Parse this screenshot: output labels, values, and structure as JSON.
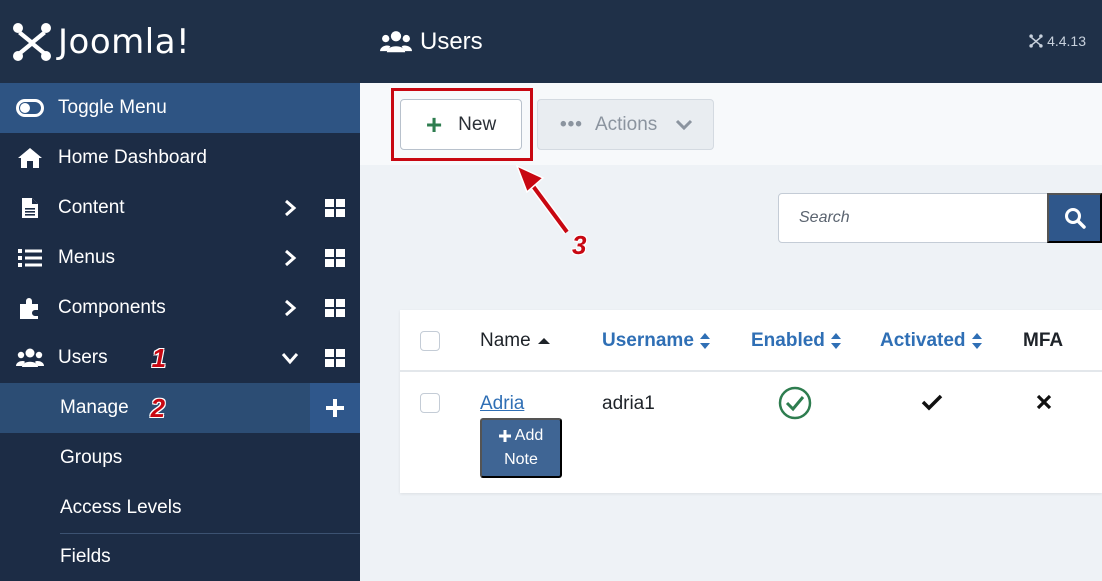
{
  "brand": {
    "name": "Joomla!"
  },
  "sidebar": {
    "toggle_label": "Toggle Menu",
    "items": [
      {
        "label": "Home Dashboard",
        "icon": "home-icon"
      },
      {
        "label": "Content",
        "icon": "file-icon"
      },
      {
        "label": "Menus",
        "icon": "list-icon"
      },
      {
        "label": "Components",
        "icon": "puzzle-icon"
      },
      {
        "label": "Users",
        "icon": "users-icon"
      }
    ],
    "users_submenu": [
      {
        "label": "Manage",
        "active": true
      },
      {
        "label": "Groups"
      },
      {
        "label": "Access Levels"
      },
      {
        "label": "Fields"
      }
    ]
  },
  "annotations": {
    "step1": "1",
    "step2": "2",
    "step3": "3",
    "highlight_color": "#c80812"
  },
  "header": {
    "title": "Users",
    "version": "4.4.13"
  },
  "toolbar": {
    "new_label": "New",
    "actions_label": "Actions"
  },
  "search": {
    "placeholder": "Search"
  },
  "table": {
    "columns": [
      {
        "label": "Name",
        "sort": "asc"
      },
      {
        "label": "Username",
        "sort": "both"
      },
      {
        "label": "Enabled",
        "sort": "both"
      },
      {
        "label": "Activated",
        "sort": "both"
      },
      {
        "label": "MFA"
      }
    ],
    "rows": [
      {
        "name": "Adria",
        "username": "adria1",
        "enabled": true,
        "activated": true,
        "mfa": false,
        "add_note_line1": "Add",
        "add_note_line2": "Note"
      }
    ]
  },
  "colors": {
    "sidebar_bg": "#1c2c45",
    "accent": "#2f578b",
    "link": "#2f6fb5",
    "success": "#2e7d4f"
  }
}
